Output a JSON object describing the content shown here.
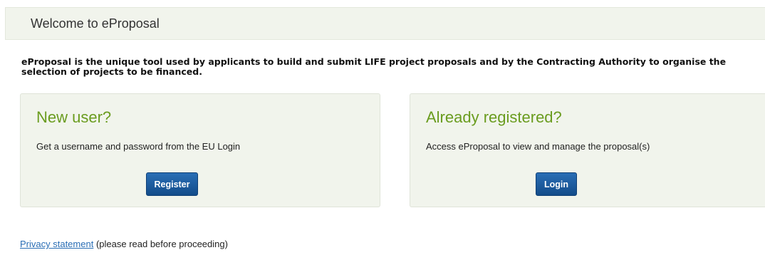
{
  "header": {
    "title": "Welcome to eProposal"
  },
  "intro": {
    "text": "eProposal is the unique tool used by applicants to build and submit LIFE project proposals and by the Contracting Authority to organise the selection of projects to be financed."
  },
  "new_user": {
    "title": "New user?",
    "description": "Get a username and password from the EU Login",
    "button_label": "Register"
  },
  "registered": {
    "title": "Already registered?",
    "description": "Access eProposal to view and manage the proposal(s)",
    "button_label": "Login"
  },
  "footer": {
    "privacy_link": "Privacy statement",
    "note": " (please read before proceeding)"
  },
  "colors": {
    "panel_bg": "#f1f4ec",
    "title_green": "#6a9c1f",
    "button_blue": "#1c5ca0",
    "link_blue": "#2a6eb5"
  }
}
